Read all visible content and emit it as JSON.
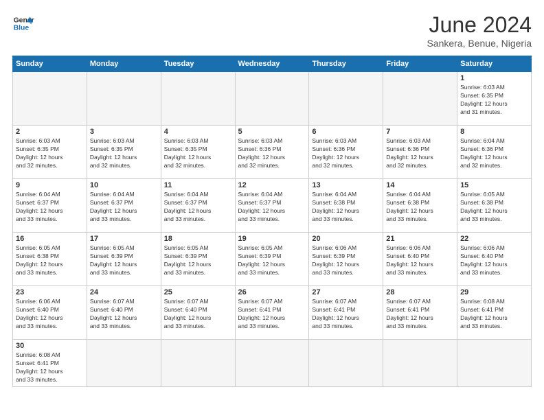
{
  "header": {
    "logo_general": "General",
    "logo_blue": "Blue",
    "month_year": "June 2024",
    "location": "Sankera, Benue, Nigeria"
  },
  "weekdays": [
    "Sunday",
    "Monday",
    "Tuesday",
    "Wednesday",
    "Thursday",
    "Friday",
    "Saturday"
  ],
  "days": {
    "d1": {
      "num": "1",
      "sunrise": "6:03 AM",
      "sunset": "6:35 PM",
      "daylight": "12 hours and 31 minutes."
    },
    "d2": {
      "num": "2",
      "sunrise": "6:03 AM",
      "sunset": "6:35 PM",
      "daylight": "12 hours and 32 minutes."
    },
    "d3": {
      "num": "3",
      "sunrise": "6:03 AM",
      "sunset": "6:35 PM",
      "daylight": "12 hours and 32 minutes."
    },
    "d4": {
      "num": "4",
      "sunrise": "6:03 AM",
      "sunset": "6:35 PM",
      "daylight": "12 hours and 32 minutes."
    },
    "d5": {
      "num": "5",
      "sunrise": "6:03 AM",
      "sunset": "6:36 PM",
      "daylight": "12 hours and 32 minutes."
    },
    "d6": {
      "num": "6",
      "sunrise": "6:03 AM",
      "sunset": "6:36 PM",
      "daylight": "12 hours and 32 minutes."
    },
    "d7": {
      "num": "7",
      "sunrise": "6:03 AM",
      "sunset": "6:36 PM",
      "daylight": "12 hours and 32 minutes."
    },
    "d8": {
      "num": "8",
      "sunrise": "6:04 AM",
      "sunset": "6:36 PM",
      "daylight": "12 hours and 32 minutes."
    },
    "d9": {
      "num": "9",
      "sunrise": "6:04 AM",
      "sunset": "6:37 PM",
      "daylight": "12 hours and 33 minutes."
    },
    "d10": {
      "num": "10",
      "sunrise": "6:04 AM",
      "sunset": "6:37 PM",
      "daylight": "12 hours and 33 minutes."
    },
    "d11": {
      "num": "11",
      "sunrise": "6:04 AM",
      "sunset": "6:37 PM",
      "daylight": "12 hours and 33 minutes."
    },
    "d12": {
      "num": "12",
      "sunrise": "6:04 AM",
      "sunset": "6:37 PM",
      "daylight": "12 hours and 33 minutes."
    },
    "d13": {
      "num": "13",
      "sunrise": "6:04 AM",
      "sunset": "6:38 PM",
      "daylight": "12 hours and 33 minutes."
    },
    "d14": {
      "num": "14",
      "sunrise": "6:04 AM",
      "sunset": "6:38 PM",
      "daylight": "12 hours and 33 minutes."
    },
    "d15": {
      "num": "15",
      "sunrise": "6:05 AM",
      "sunset": "6:38 PM",
      "daylight": "12 hours and 33 minutes."
    },
    "d16": {
      "num": "16",
      "sunrise": "6:05 AM",
      "sunset": "6:38 PM",
      "daylight": "12 hours and 33 minutes."
    },
    "d17": {
      "num": "17",
      "sunrise": "6:05 AM",
      "sunset": "6:39 PM",
      "daylight": "12 hours and 33 minutes."
    },
    "d18": {
      "num": "18",
      "sunrise": "6:05 AM",
      "sunset": "6:39 PM",
      "daylight": "12 hours and 33 minutes."
    },
    "d19": {
      "num": "19",
      "sunrise": "6:05 AM",
      "sunset": "6:39 PM",
      "daylight": "12 hours and 33 minutes."
    },
    "d20": {
      "num": "20",
      "sunrise": "6:06 AM",
      "sunset": "6:39 PM",
      "daylight": "12 hours and 33 minutes."
    },
    "d21": {
      "num": "21",
      "sunrise": "6:06 AM",
      "sunset": "6:40 PM",
      "daylight": "12 hours and 33 minutes."
    },
    "d22": {
      "num": "22",
      "sunrise": "6:06 AM",
      "sunset": "6:40 PM",
      "daylight": "12 hours and 33 minutes."
    },
    "d23": {
      "num": "23",
      "sunrise": "6:06 AM",
      "sunset": "6:40 PM",
      "daylight": "12 hours and 33 minutes."
    },
    "d24": {
      "num": "24",
      "sunrise": "6:07 AM",
      "sunset": "6:40 PM",
      "daylight": "12 hours and 33 minutes."
    },
    "d25": {
      "num": "25",
      "sunrise": "6:07 AM",
      "sunset": "6:40 PM",
      "daylight": "12 hours and 33 minutes."
    },
    "d26": {
      "num": "26",
      "sunrise": "6:07 AM",
      "sunset": "6:41 PM",
      "daylight": "12 hours and 33 minutes."
    },
    "d27": {
      "num": "27",
      "sunrise": "6:07 AM",
      "sunset": "6:41 PM",
      "daylight": "12 hours and 33 minutes."
    },
    "d28": {
      "num": "28",
      "sunrise": "6:07 AM",
      "sunset": "6:41 PM",
      "daylight": "12 hours and 33 minutes."
    },
    "d29": {
      "num": "29",
      "sunrise": "6:08 AM",
      "sunset": "6:41 PM",
      "daylight": "12 hours and 33 minutes."
    },
    "d30": {
      "num": "30",
      "sunrise": "6:08 AM",
      "sunset": "6:41 PM",
      "daylight": "12 hours and 33 minutes."
    }
  },
  "labels": {
    "sunrise": "Sunrise:",
    "sunset": "Sunset:",
    "daylight": "Daylight:"
  }
}
